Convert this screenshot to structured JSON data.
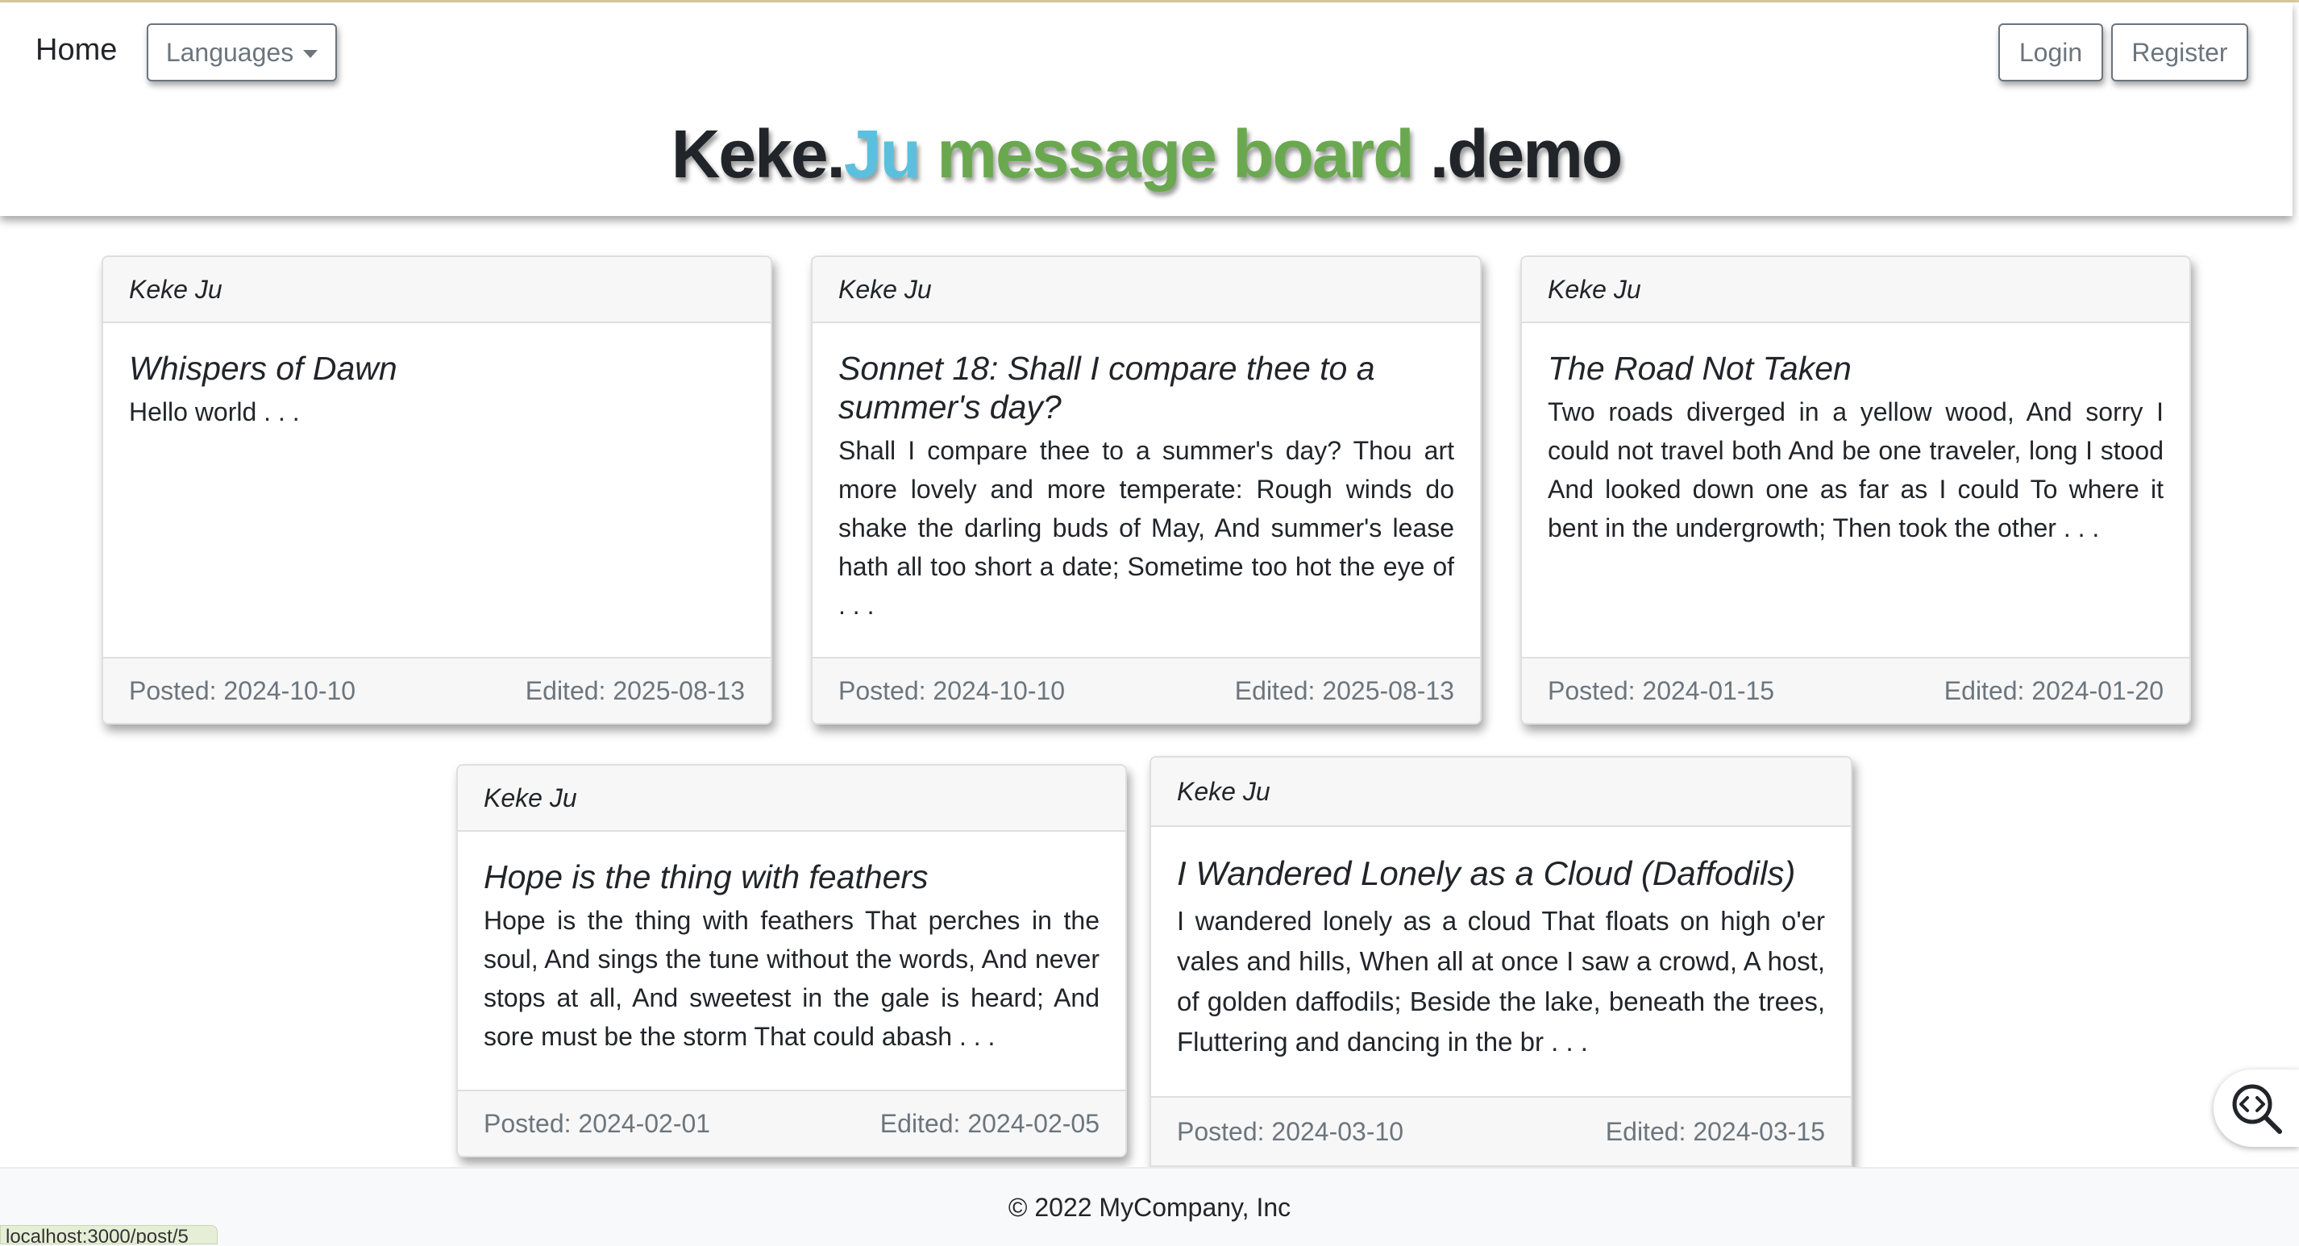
{
  "nav": {
    "home": "Home",
    "languages": "Languages",
    "login": "Login",
    "register": "Register"
  },
  "title": {
    "part1": "Keke.",
    "part2": "Ju",
    "part3": "message board",
    "part4": ".demo"
  },
  "posts": [
    {
      "author": "Keke Ju",
      "title": "Whispers of Dawn",
      "excerpt": "Hello world . . .",
      "posted": "Posted: 2024-10-10",
      "edited": "Edited: 2025-08-13"
    },
    {
      "author": "Keke Ju",
      "title": "Sonnet 18: Shall I compare thee to a summer's day?",
      "excerpt": "Shall I compare thee to a summer's day? Thou art more lovely and more temperate: Rough winds do shake the darling buds of May, And summer's lease hath all too short a date; Sometime too hot the eye of . . .",
      "posted": "Posted: 2024-10-10",
      "edited": "Edited: 2025-08-13"
    },
    {
      "author": "Keke Ju",
      "title": "The Road Not Taken",
      "excerpt": "Two roads diverged in a yellow wood, And sorry I could not travel both And be one traveler, long I stood And looked down one as far as I could To where it bent in the undergrowth; Then took the other . . .",
      "posted": "Posted: 2024-01-15",
      "edited": "Edited: 2024-01-20"
    },
    {
      "author": "Keke Ju",
      "title": "Hope is the thing with feathers",
      "excerpt": "Hope is the thing with feathers That perches in the soul, And sings the tune without the words, And never stops at all, And sweetest in the gale is heard; And sore must be the storm That could abash . . .",
      "posted": "Posted: 2024-02-01",
      "edited": "Edited: 2024-02-05"
    },
    {
      "author": "Keke Ju",
      "title": "I Wandered Lonely as a Cloud (Daffodils)",
      "excerpt": "I wandered lonely as a cloud That floats on high o'er vales and hills, When all at once I saw a crowd, A host, of golden daffodils; Beside the lake, beneath the trees, Fluttering and dancing in the br . . .",
      "posted": "Posted: 2024-03-10",
      "edited": "Edited: 2024-03-15"
    }
  ],
  "footer": {
    "copyright": "© 2022 MyCompany, Inc"
  },
  "status_bar": {
    "url": "localhost:3000/post/5"
  },
  "colors": {
    "accent_blue": "#5bc0de",
    "accent_green": "#6aa84f",
    "muted": "#6c757d"
  }
}
